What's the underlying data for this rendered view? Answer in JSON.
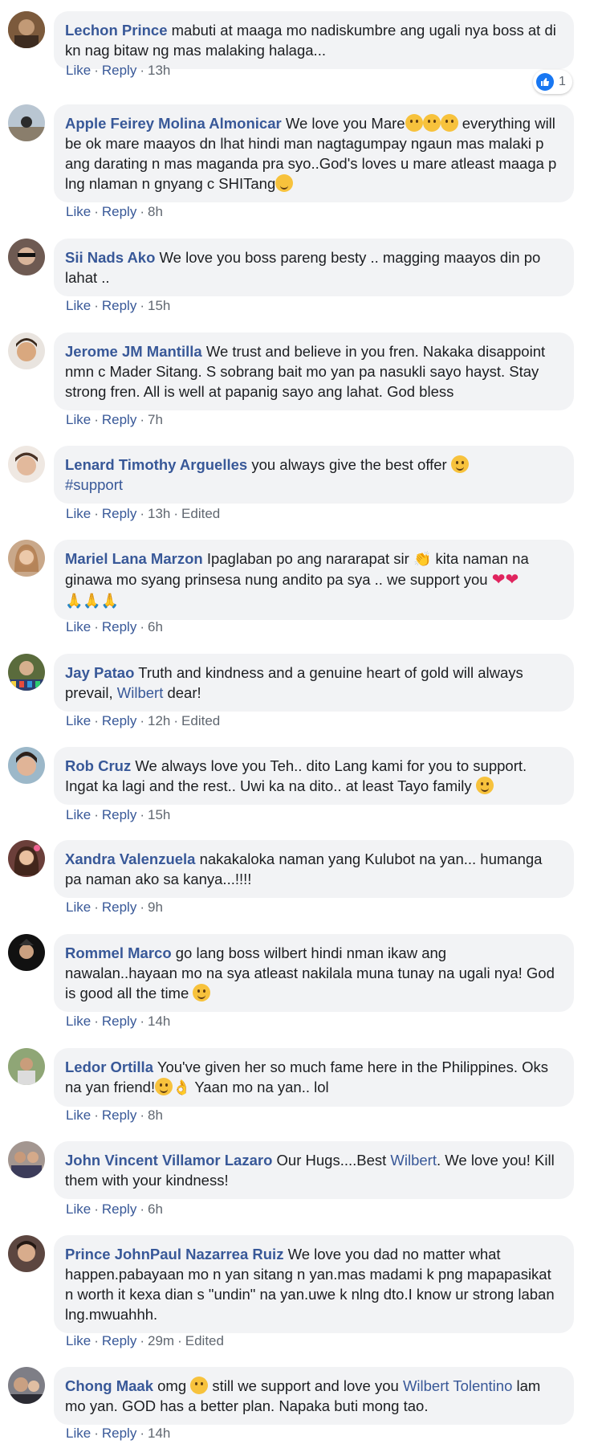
{
  "actions": {
    "like": "Like",
    "reply": "Reply",
    "edited": "Edited"
  },
  "reaction": {
    "count": "1"
  },
  "comments": [
    {
      "author": "Lechon Prince",
      "text": "mabuti at maaga mo nadiskumbre ang ugali nya boss at di kn nag bitaw ng mas malaking halaga...",
      "time": "13h"
    },
    {
      "author": "Apple Feirey Molina Almonicar",
      "text_a": "We love you Mare",
      "text_b": "everything will be ok mare maayos dn lhat hindi man nagtagumpay ngaun mas malaki p ang darating n mas maganda pra syo..God's loves u mare atleast maaga p lng nlaman n gnyang c SHITang",
      "time": "8h"
    },
    {
      "author": "Sii Nads Ako",
      "text": "We love you boss pareng besty .. magging maayos din po lahat ..",
      "time": "15h"
    },
    {
      "author": "Jerome JM Mantilla",
      "text": "We trust and believe in you fren. Nakaka disappoint nmn c Mader Sitang. S sobrang bait mo yan pa nasukli sayo hayst. Stay strong fren. All is well at papanig sayo ang lahat. God bless",
      "time": "7h"
    },
    {
      "author": "Lenard Timothy Arguelles",
      "text": "you always give the best offer",
      "hashtag": "#support",
      "time": "13h"
    },
    {
      "author": "Mariel Lana Marzon",
      "text_a": "Ipaglaban po ang nararapat sir",
      "text_b": "kita naman na ginawa mo syang prinsesa nung andito pa sya .. we support you",
      "time": "6h"
    },
    {
      "author": "Jay Patao",
      "text": "Truth and kindness and a genuine heart of gold will always prevail,",
      "mention": "Wilbert",
      "text_end": "dear!",
      "time": "12h"
    },
    {
      "author": "Rob Cruz",
      "text": "We always love you Teh.. dito Lang kami for you to support. Ingat ka lagi and the rest.. Uwi ka na dito.. at least Tayo family",
      "time": "15h"
    },
    {
      "author": "Xandra Valenzuela",
      "text": "nakakaloka naman yang Kulubot na yan... humanga pa naman ako sa kanya...!!!!",
      "time": "9h"
    },
    {
      "author": "Rommel Marco",
      "text": "go lang boss wilbert hindi nman ikaw ang nawalan..hayaan mo na sya atleast nakilala muna tunay na ugali nya! God is good all the time",
      "time": "14h"
    },
    {
      "author": "Ledor Ortilla",
      "text_a": "You've given her so much fame here in the Philippines. Oks na yan friend!",
      "text_b": "Yaan mo na yan.. lol",
      "time": "8h"
    },
    {
      "author": "John Vincent Villamor Lazaro",
      "text": "Our Hugs....Best",
      "mention": "Wilbert",
      "text_end": ". We love you! Kill them with your kindness!",
      "time": "6h"
    },
    {
      "author": "Prince JohnPaul Nazarrea Ruiz",
      "text": "We love you dad no matter what happen.pabayaan mo n yan sitang n yan.mas madami k png mapapasikat n worth it kexa dian s \"undin\" na yan.uwe k nlng dto.I know ur strong laban lng.mwuahhh.",
      "time": "29m"
    },
    {
      "author": "Chong Maak",
      "text_a": "omg",
      "text_b": "still we support and love you",
      "mention": "Wilbert Tolentino",
      "text_end": "lam mo yan. GOD has a better plan. Napaka buti mong tao.",
      "time": "14h"
    }
  ]
}
